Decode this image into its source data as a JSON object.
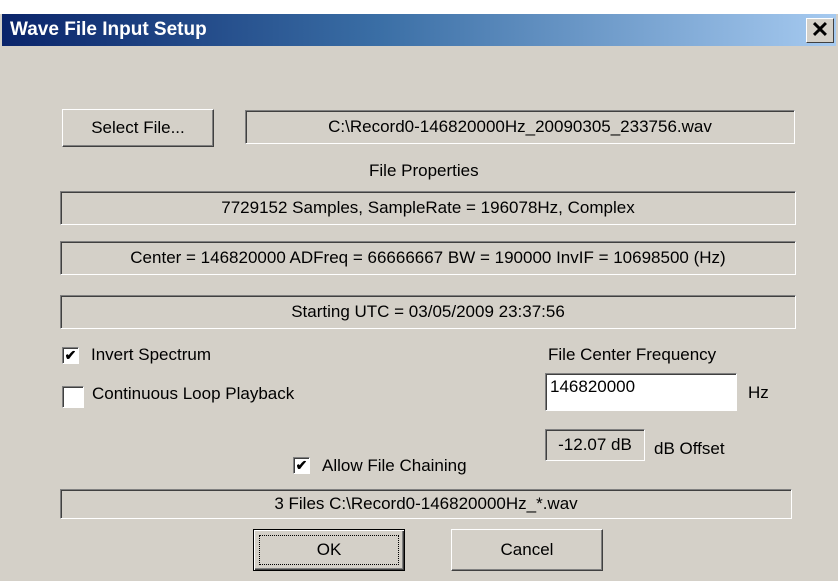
{
  "window": {
    "title": "Wave File Input Setup",
    "close_glyph": "✕"
  },
  "file": {
    "select_button": "Select File...",
    "path": "C:\\Record0-146820000Hz_20090305_233756.wav"
  },
  "properties": {
    "heading": "File Properties",
    "samples": "7729152 Samples,  SampleRate = 196078Hz,  Complex",
    "center": "Center = 146820000  ADFreq = 66666667  BW = 190000  InvIF = 10698500 (Hz)",
    "utc": "Starting UTC = 03/05/2009 23:37:56"
  },
  "options": {
    "invert_spectrum": {
      "label": "Invert Spectrum",
      "checked": true
    },
    "continuous_loop": {
      "label": "Continuous Loop Playback",
      "checked": false
    },
    "allow_chaining": {
      "label": "Allow File Chaining",
      "checked": true
    }
  },
  "center_freq": {
    "label": "File Center Frequency",
    "value": "146820000",
    "unit": "Hz"
  },
  "offset": {
    "value": "-12.07 dB",
    "label": "dB Offset"
  },
  "chain_files": "3 Files  C:\\Record0-146820000Hz_*.wav",
  "buttons": {
    "ok": "OK",
    "cancel": "Cancel"
  }
}
